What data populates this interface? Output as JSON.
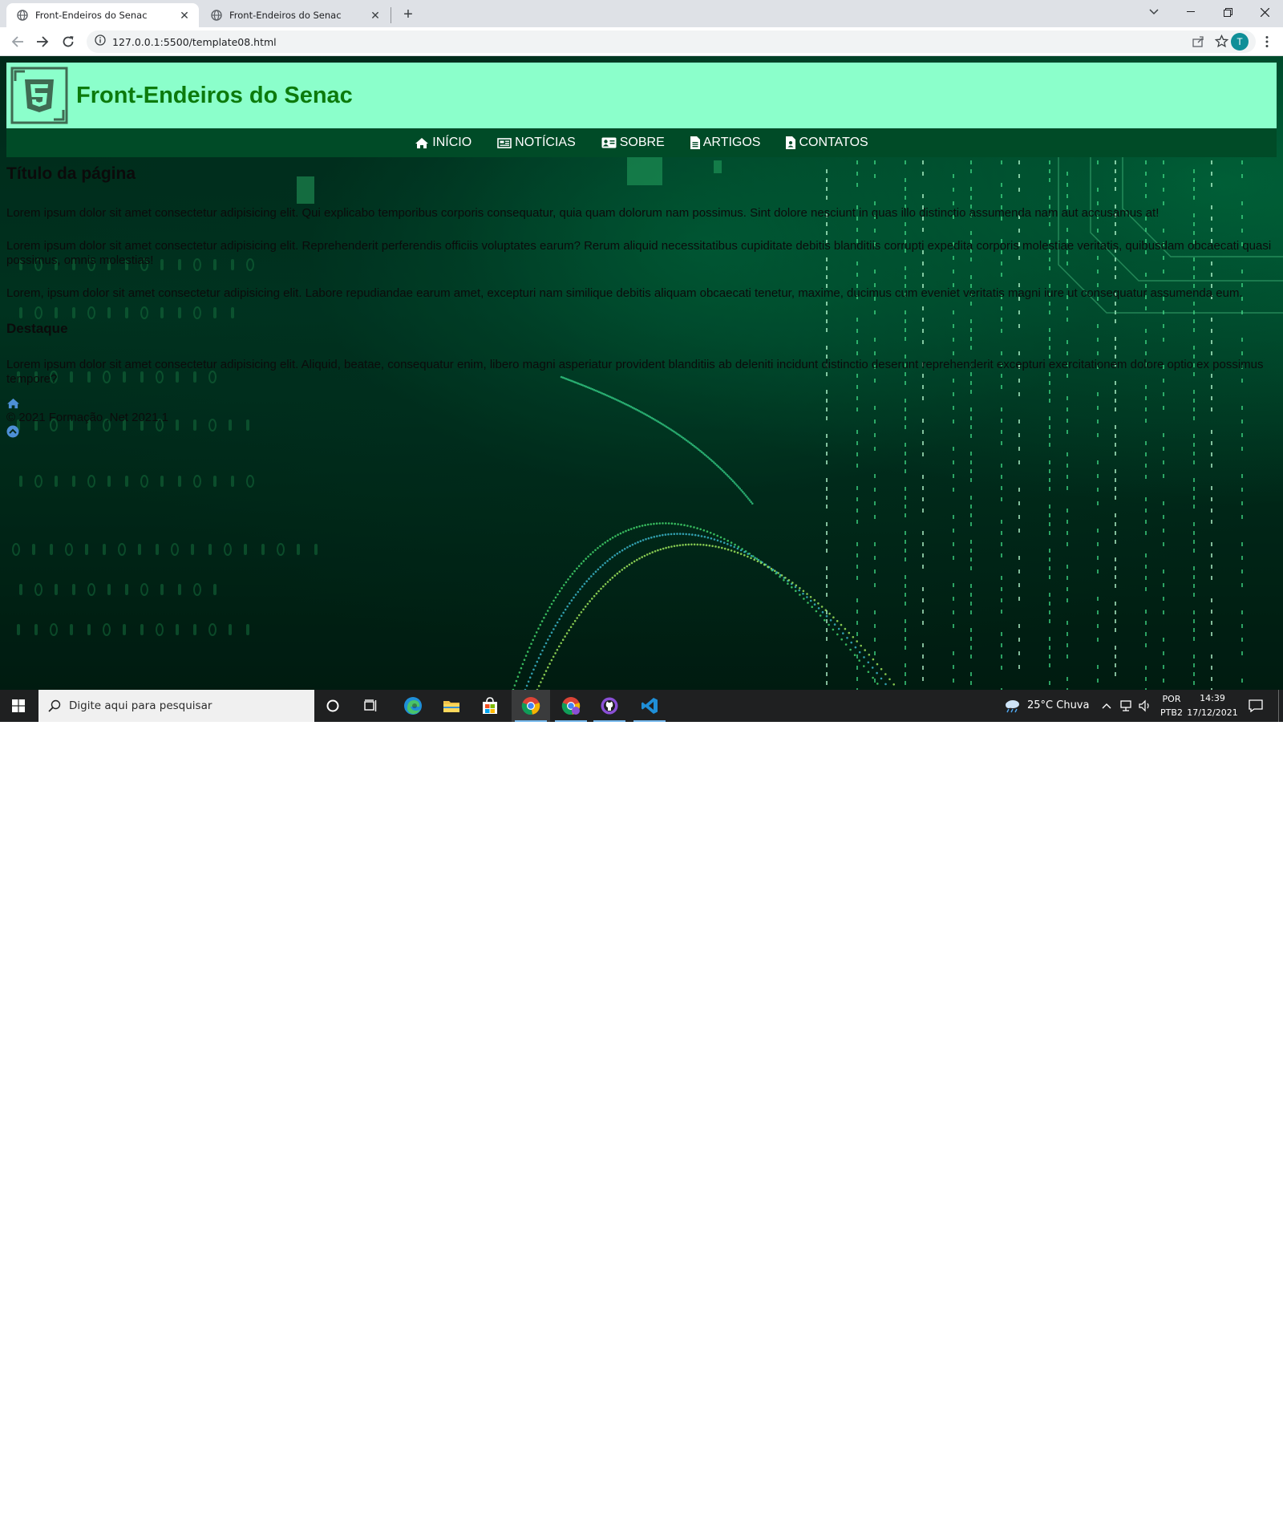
{
  "browser": {
    "tabs": [
      {
        "title": "Front-Endeiros do Senac",
        "active": true
      },
      {
        "title": "Front-Endeiros do Senac",
        "active": false
      }
    ],
    "url": "127.0.0.1:5500/template08.html",
    "profile_initial": "T"
  },
  "site": {
    "title": "Front-Endeiros do Senac",
    "nav": [
      {
        "label": "INÍCIO",
        "icon": "home-icon"
      },
      {
        "label": "NOTÍCIAS",
        "icon": "newspaper-icon"
      },
      {
        "label": "SOBRE",
        "icon": "id-card-icon"
      },
      {
        "label": "ARTIGOS",
        "icon": "file-icon"
      },
      {
        "label": "CONTATOS",
        "icon": "file-contact-icon"
      }
    ]
  },
  "content": {
    "page_title": "Título da página",
    "paragraphs": [
      "Lorem ipsum dolor sit amet consectetur adipisicing elit. Qui explicabo temporibus corporis consequatur, quia quam dolorum nam possimus. Sint dolore nesciunt in quas illo distinctio assumenda nam aut accusamus at!",
      "Lorem ipsum dolor sit amet consectetur adipisicing elit. Reprehenderit perferendis officiis voluptates earum? Rerum aliquid necessitatibus cupiditate debitis blanditiis corrupti expedita corporis molestiae veritatis, quibusdam obcaecati quasi possimus, omnis molestias!",
      "Lorem, ipsum dolor sit amet consectetur adipisicing elit. Labore repudiandae earum amet, excepturi nam similique debitis aliquam obcaecati tenetur, maxime, ducimus cum eveniet veritatis magni iure ut consequatur assumenda eum."
    ],
    "highlight_title": "Destaque",
    "highlight_text": "Lorem ipsum dolor sit amet consectetur adipisicing elit. Aliquid, beatae, consequatur enim, libero magni asperiatur provident blanditiis ab deleniti incidunt distinctio deserunt reprehenderit excepturi exercitationem dolore optio ex possimus tempore?",
    "footer_copy": "© 2021 Formação .Net 2021.1"
  },
  "taskbar": {
    "search_placeholder": "Digite aqui para pesquisar",
    "weather": "25°C  Chuva",
    "lang_top": "POR",
    "lang_bottom": "PTB2",
    "time": "14:39",
    "date": "17/12/2021"
  },
  "colors": {
    "header_bg": "#8bffcb",
    "header_title": "#0c7a0c",
    "nav_bg": "#004b27",
    "page_bg": "#00301d"
  }
}
